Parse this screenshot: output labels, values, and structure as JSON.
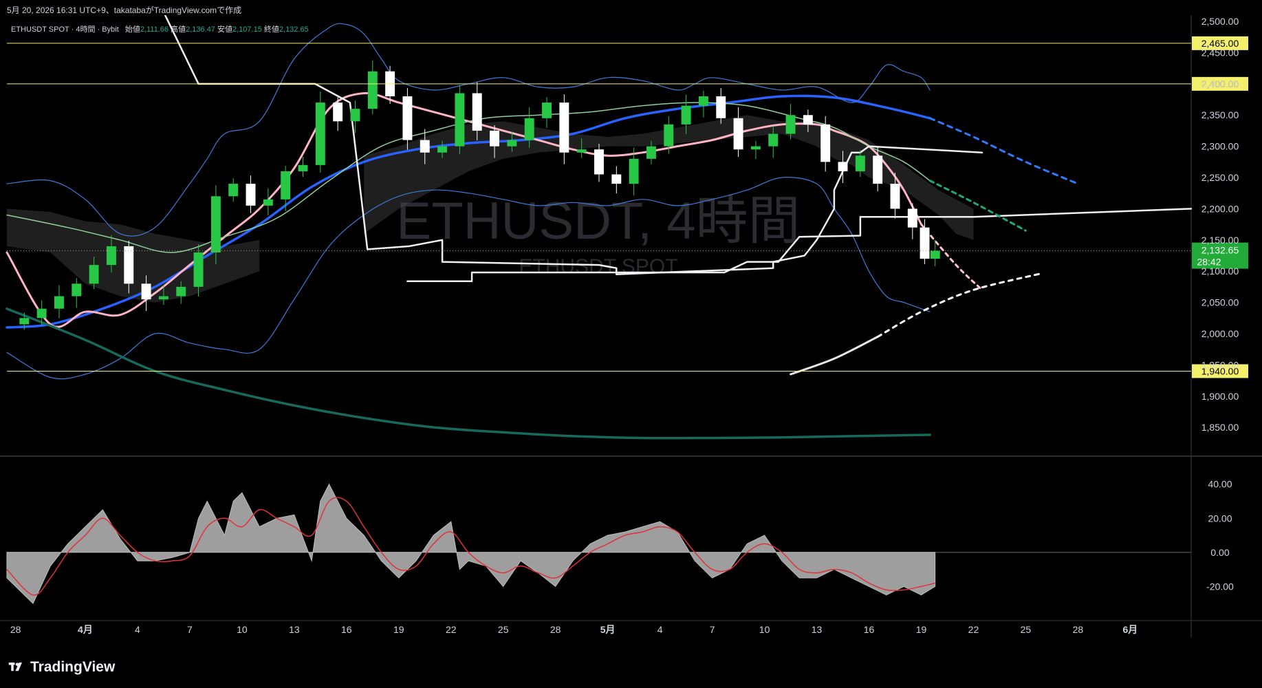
{
  "header": {
    "snapshot_info": "5月 20, 2026 16:31 UTC+9、takatabaがTradingView.comで作成",
    "symbol_line": "ETHUSDT SPOT · 4時間 · Bybit",
    "ohlc": {
      "open_label": "始値",
      "open": "2,111.66",
      "high_label": "高値",
      "high": "2,136.47",
      "low_label": "安値",
      "low": "2,107.15",
      "close_label": "終値",
      "close": "2,132.65"
    }
  },
  "watermark": {
    "main": "ETHUSDT, 4時間",
    "sub": "ETHUSDT SPOT"
  },
  "brand": {
    "name": "TradingView"
  },
  "colors": {
    "background": "#000000",
    "up": "#26c846",
    "down": "#ffffff",
    "ma_blue": "#2962ff",
    "ma_pink": "#ffb3c6",
    "ma_green": "#8fcf9b",
    "bollinger": "#3d7bd9",
    "ma_long": "#17695a",
    "hline": "#f4f06b",
    "current_price": "#22ab38",
    "osc_fill": "#9e9e9e",
    "osc_signal": "#e0323c"
  },
  "chart_data": {
    "type": "line",
    "title": "ETHUSDT, 4時間",
    "xlabel": "",
    "ylabel": "",
    "ylim": [
      1805,
      2510
    ],
    "yticks": [
      "2,500.00",
      "2,450.00",
      "2,400.00",
      "2,350.00",
      "2,300.00",
      "2,250.00",
      "2,200.00",
      "2,150.00",
      "2,100.00",
      "2,050.00",
      "2,000.00",
      "1,950.00",
      "1,900.00",
      "1,850.00"
    ],
    "ytick_values": [
      2500,
      2450,
      2400,
      2350,
      2300,
      2250,
      2200,
      2150,
      2100,
      2050,
      2000,
      1950,
      1900,
      1850
    ],
    "xticks": [
      "28",
      "4月",
      "4",
      "7",
      "10",
      "13",
      "16",
      "19",
      "22",
      "25",
      "28",
      "5月",
      "4",
      "7",
      "10",
      "13",
      "16",
      "19",
      "22",
      "25",
      "28",
      "6月"
    ],
    "xtick_days": [
      0,
      4,
      7,
      10,
      13,
      16,
      19,
      22,
      25,
      28,
      31,
      34,
      37,
      40,
      43,
      46,
      49,
      52,
      55,
      58,
      61,
      64
    ],
    "xlim_days": [
      -0.5,
      67.5
    ],
    "horizontal_lines": [
      {
        "label": "2,465.00",
        "value": 2465
      },
      {
        "label": "2,400.00",
        "value": 2400
      },
      {
        "label": "1,940.00",
        "value": 1940
      }
    ],
    "current_price": {
      "label": "2,132.65",
      "value": 2132.65,
      "countdown": "28:42"
    },
    "series": [
      {
        "style": "ma_blue",
        "x": [
          -0.5,
          2,
          5,
          8,
          11,
          14,
          17,
          20,
          23,
          26,
          29,
          32,
          35,
          38,
          41,
          44,
          47,
          50,
          52.5
        ],
        "y": [
          2010,
          2015,
          2040,
          2075,
          2125,
          2175,
          2235,
          2275,
          2295,
          2305,
          2310,
          2320,
          2345,
          2360,
          2370,
          2380,
          2378,
          2362,
          2345
        ]
      },
      {
        "style": "ma_pink",
        "x": [
          -0.5,
          2,
          4,
          6,
          8,
          10,
          12,
          14,
          16,
          18,
          20,
          22,
          24,
          26,
          28,
          30,
          32,
          34,
          36,
          38,
          40,
          42,
          44,
          46,
          47,
          48,
          49,
          50,
          51,
          52
        ],
        "y": [
          2130,
          2015,
          2035,
          2030,
          2065,
          2110,
          2155,
          2200,
          2265,
          2360,
          2385,
          2370,
          2355,
          2340,
          2325,
          2310,
          2295,
          2285,
          2290,
          2300,
          2310,
          2325,
          2335,
          2335,
          2325,
          2315,
          2300,
          2270,
          2230,
          2175
        ]
      },
      {
        "style": "ma_green",
        "x": [
          -0.5,
          3,
          6,
          9,
          12,
          15,
          18,
          21,
          24,
          27,
          30,
          33,
          36,
          39,
          42,
          45,
          47,
          49,
          51,
          52.5
        ],
        "y": [
          2190,
          2170,
          2150,
          2130,
          2155,
          2185,
          2245,
          2300,
          2325,
          2345,
          2350,
          2355,
          2365,
          2370,
          2365,
          2345,
          2330,
          2300,
          2275,
          2245
        ]
      },
      {
        "style": "bollinger",
        "x": [
          -0.5,
          2,
          4,
          6,
          8,
          10,
          11,
          12,
          14,
          16,
          18,
          19,
          20,
          21,
          22,
          24,
          26,
          28,
          30,
          32,
          34,
          36,
          38,
          39,
          40,
          42,
          44,
          46,
          48,
          49,
          50,
          51,
          52,
          52.5
        ],
        "y": [
          2240,
          2245,
          2215,
          2160,
          2170,
          2240,
          2280,
          2320,
          2340,
          2440,
          2490,
          2495,
          2480,
          2440,
          2405,
          2390,
          2400,
          2410,
          2395,
          2395,
          2410,
          2405,
          2390,
          2400,
          2410,
          2400,
          2390,
          2395,
          2370,
          2395,
          2430,
          2420,
          2410,
          2390
        ]
      },
      {
        "style": "bollinger",
        "x": [
          -0.5,
          2,
          4,
          6,
          8,
          10,
          12,
          14,
          16,
          18,
          20,
          22,
          24,
          26,
          28,
          30,
          32,
          34,
          36,
          38,
          40,
          42,
          44,
          46,
          47,
          48,
          49,
          50,
          51,
          52,
          52.5
        ],
        "y": [
          1970,
          1930,
          1935,
          1960,
          2000,
          1985,
          1975,
          1975,
          2055,
          2140,
          2190,
          2220,
          2230,
          2225,
          2215,
          2205,
          2210,
          2205,
          2215,
          2205,
          2215,
          2230,
          2250,
          2240,
          2200,
          2160,
          2100,
          2060,
          2050,
          2040,
          2035
        ]
      },
      {
        "style": "ma_long",
        "x": [
          -0.5,
          4,
          8,
          12,
          16,
          20,
          24,
          28,
          32,
          36,
          40,
          44,
          48,
          52.5
        ],
        "y": [
          2040,
          1990,
          1940,
          1910,
          1885,
          1865,
          1850,
          1842,
          1836,
          1833,
          1833,
          1834,
          1836,
          1838
        ]
      },
      {
        "style": "zigzag",
        "x": [
          8.5,
          10.5,
          17.2,
          19.2,
          20.2,
          22.6,
          24.5,
          24.5,
          33.5,
          34.5,
          34.5,
          43.5,
          43.5,
          45.3,
          46,
          47,
          47,
          48,
          48.5,
          49,
          55.5
        ],
        "y": [
          2515,
          2400,
          2400,
          2370,
          2135,
          2140,
          2150,
          2115,
          2110,
          2105,
          2095,
          2105,
          2115,
          2125,
          2150,
          2200,
          2230,
          2290,
          2290,
          2300,
          2290
        ]
      },
      {
        "style": "support_step",
        "x": [
          22.5,
          26.2,
          26.2,
          40.7,
          42,
          43.8,
          45,
          45,
          48.5,
          48.5,
          53.5,
          55,
          67.5
        ],
        "y": [
          2084,
          2084,
          2098,
          2098,
          2115,
          2115,
          2155,
          2155,
          2157,
          2187,
          2187,
          2187,
          2200
        ]
      },
      {
        "style": "blue_proj",
        "x": [
          52.5,
          55,
          58,
          61
        ],
        "y": [
          2345,
          2315,
          2275,
          2240
        ]
      },
      {
        "style": "green_proj",
        "x": [
          52.5,
          55,
          58
        ],
        "y": [
          2245,
          2210,
          2165
        ]
      },
      {
        "style": "pink_proj",
        "x": [
          52,
          54,
          55.5
        ],
        "y": [
          2175,
          2110,
          2070
        ]
      },
      {
        "style": "white_arc",
        "x": [
          44.5,
          47,
          49.5
        ],
        "y": [
          1935,
          1960,
          1995
        ]
      },
      {
        "style": "white_arc_proj",
        "x": [
          49.5,
          52,
          55,
          59
        ],
        "y": [
          1995,
          2035,
          2070,
          2097
        ]
      }
    ],
    "candles": [
      {
        "x": 0.5,
        "y": 2025
      },
      {
        "x": 1.5,
        "y": 2040
      },
      {
        "x": 2.5,
        "y": 2060
      },
      {
        "x": 3.5,
        "y": 2080
      },
      {
        "x": 4.5,
        "y": 2110
      },
      {
        "x": 5.5,
        "y": 2140
      },
      {
        "x": 6.5,
        "y": 2080
      },
      {
        "x": 7.5,
        "y": 2055
      },
      {
        "x": 8.5,
        "y": 2060
      },
      {
        "x": 9.5,
        "y": 2075
      },
      {
        "x": 10.5,
        "y": 2130
      },
      {
        "x": 11.5,
        "y": 2220
      },
      {
        "x": 12.5,
        "y": 2240
      },
      {
        "x": 13.5,
        "y": 2205
      },
      {
        "x": 14.5,
        "y": 2215
      },
      {
        "x": 15.5,
        "y": 2260
      },
      {
        "x": 16.5,
        "y": 2270
      },
      {
        "x": 17.5,
        "y": 2370
      },
      {
        "x": 18.5,
        "y": 2340
      },
      {
        "x": 19.5,
        "y": 2360
      },
      {
        "x": 20.5,
        "y": 2420
      },
      {
        "x": 21.5,
        "y": 2380
      },
      {
        "x": 22.5,
        "y": 2310
      },
      {
        "x": 23.5,
        "y": 2290
      },
      {
        "x": 24.5,
        "y": 2300
      },
      {
        "x": 25.5,
        "y": 2385
      },
      {
        "x": 26.5,
        "y": 2325
      },
      {
        "x": 27.5,
        "y": 2300
      },
      {
        "x": 28.5,
        "y": 2310
      },
      {
        "x": 29.5,
        "y": 2345
      },
      {
        "x": 30.5,
        "y": 2370
      },
      {
        "x": 31.5,
        "y": 2290
      },
      {
        "x": 32.5,
        "y": 2295
      },
      {
        "x": 33.5,
        "y": 2255
      },
      {
        "x": 34.5,
        "y": 2240
      },
      {
        "x": 35.5,
        "y": 2280
      },
      {
        "x": 36.5,
        "y": 2300
      },
      {
        "x": 37.5,
        "y": 2335
      },
      {
        "x": 38.5,
        "y": 2365
      },
      {
        "x": 39.5,
        "y": 2380
      },
      {
        "x": 40.5,
        "y": 2345
      },
      {
        "x": 41.5,
        "y": 2295
      },
      {
        "x": 42.5,
        "y": 2300
      },
      {
        "x": 43.5,
        "y": 2320
      },
      {
        "x": 44.5,
        "y": 2350
      },
      {
        "x": 45.5,
        "y": 2335
      },
      {
        "x": 46.5,
        "y": 2275
      },
      {
        "x": 47.5,
        "y": 2260
      },
      {
        "x": 48.5,
        "y": 2285
      },
      {
        "x": 49.5,
        "y": 2240
      },
      {
        "x": 50.5,
        "y": 2200
      },
      {
        "x": 51.5,
        "y": 2170
      },
      {
        "x": 52.2,
        "y": 2120
      },
      {
        "x": 52.8,
        "y": 2132.65
      }
    ]
  },
  "oscillator_data": {
    "type": "area",
    "ylim": [
      -40,
      56
    ],
    "yticks": [
      "40.00",
      "20.00",
      "0.00",
      "-20.00"
    ],
    "ytick_values": [
      40,
      20,
      0,
      -20
    ],
    "histogram": {
      "x": [
        -0.5,
        1,
        2,
        3,
        4,
        5,
        6,
        7,
        8,
        9,
        10,
        10.5,
        11,
        12,
        12.5,
        13,
        14,
        15,
        16,
        17,
        17.5,
        18,
        19,
        20,
        21,
        22,
        23,
        24,
        25,
        25.5,
        26,
        27,
        28,
        29,
        30,
        31,
        32,
        33,
        34,
        35,
        36,
        37,
        38,
        39,
        40,
        41,
        42,
        43,
        44,
        45,
        46,
        47,
        48,
        49,
        50,
        51,
        52,
        52.8
      ],
      "y": [
        -15,
        -30,
        -8,
        5,
        15,
        25,
        8,
        -5,
        -5,
        -3,
        0,
        20,
        30,
        10,
        30,
        35,
        15,
        20,
        22,
        -5,
        30,
        40,
        20,
        10,
        -5,
        -15,
        -5,
        10,
        18,
        -10,
        -5,
        -8,
        -20,
        -5,
        -12,
        -20,
        -5,
        5,
        10,
        12,
        15,
        18,
        12,
        -5,
        -15,
        -10,
        5,
        10,
        -5,
        -15,
        -15,
        -10,
        -15,
        -20,
        -25,
        -20,
        -25,
        -20
      ]
    },
    "signal": {
      "x": [
        -0.5,
        1,
        2,
        3,
        4,
        5,
        6,
        7,
        8,
        9,
        10,
        11,
        12,
        13,
        14,
        15,
        16,
        17,
        18,
        19,
        20,
        21,
        22,
        23,
        24,
        25,
        26,
        27,
        28,
        29,
        30,
        31,
        32,
        33,
        34,
        35,
        36,
        37,
        38,
        39,
        40,
        41,
        42,
        43,
        44,
        45,
        46,
        47,
        48,
        49,
        50,
        51,
        52,
        52.8
      ],
      "y": [
        -10,
        -25,
        -15,
        0,
        10,
        20,
        10,
        0,
        -5,
        -5,
        -2,
        15,
        20,
        15,
        25,
        20,
        15,
        10,
        30,
        30,
        15,
        0,
        -10,
        -8,
        5,
        12,
        0,
        -8,
        -12,
        -8,
        -12,
        -15,
        -8,
        0,
        5,
        10,
        12,
        15,
        12,
        0,
        -10,
        -10,
        0,
        5,
        0,
        -10,
        -12,
        -10,
        -12,
        -18,
        -22,
        -22,
        -20,
        -18
      ]
    }
  }
}
